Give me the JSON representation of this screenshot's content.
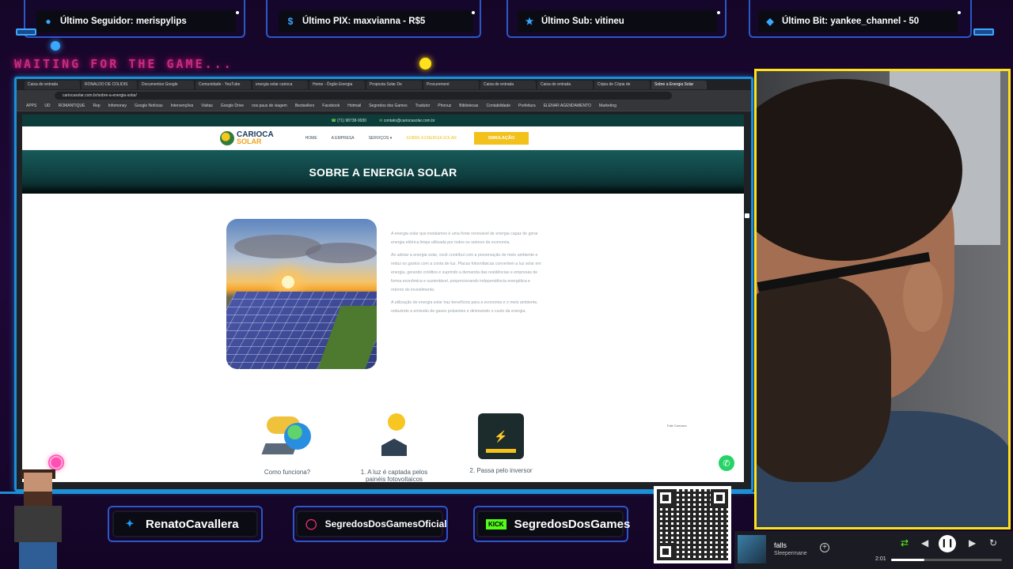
{
  "overlay": {
    "waiting_text": "WAITING FOR THE GAME...",
    "latest": [
      {
        "label": "Último Seguidor: merispylips",
        "icon": "user-icon"
      },
      {
        "label": "Último PIX: maxvianna - R$5",
        "icon": "dollar-icon"
      },
      {
        "label": "Último Sub: vitineu",
        "icon": "star-icon"
      },
      {
        "label": "Último Bit: yankee_channel - 50",
        "icon": "gem-icon"
      }
    ]
  },
  "browser": {
    "tabs": [
      "Caixa de entrada",
      "RONALDO DE COLIDIS",
      "Documentos Google",
      "Comunidade - YouTube",
      "energia solar carioca",
      "Home - Órgão Energia",
      "Proposta Solar De",
      "Procurement",
      "Caixa de entrada",
      "Caixa de entrada",
      "Cópia de Cópia de",
      "Sobre a Energia Solar"
    ],
    "active_tab_index": 11,
    "url": "cariocasolar.com.br/sobre-a-energia-solar/",
    "bookmarks": [
      "APPS",
      "UD",
      "ROMANTIQUE",
      "Rep",
      "Infomoney",
      "Google Notícias",
      "Intervenções",
      "Visitas",
      "Google Drive",
      "nos paus de viagem",
      "Bestsellers",
      "Facebook",
      "Hotmail",
      "Segredos dos Games",
      "Tradutor",
      "Phonuz",
      "Bibliotecas",
      "Contabilidade",
      "Prefeitura",
      "ELENAR AGENDAMENTO",
      "Marketing"
    ]
  },
  "site": {
    "phone": "(71) 98738-9930",
    "email": "contato@cariocasolar.com.br",
    "logo": {
      "line1": "CARIOCA",
      "line2": "SOLAR"
    },
    "menu": [
      "HOME",
      "A EMPRESA",
      "SERVIÇOS ▾",
      "SOBRE A ENERGIA SOLAR"
    ],
    "cta": "SIMULAÇÃO",
    "hero_title": "SOBRE A ENERGIA SOLAR",
    "paragraphs": [
      "A energia solar que instalamos é uma fonte renovável de energia capaz de gerar energia elétrica limpa utilizada por todos os setores da economia.",
      "Ao adotar a energia solar, você contribui com a preservação do meio ambiente e reduz os gastos com a conta de luz. Placas fotovoltaicas convertem a luz solar em energia, gerando créditos e suprindo a demanda das residências e empresas de forma econômica e sustentável, proporcionando independência energética e retorno do investimento.",
      "A utilização de energia solar traz benefícios para a economia e o meio ambiente, reduzindo a emissão de gases poluentes e diminuindo o custo da energia."
    ],
    "steps": [
      {
        "label": "Como funciona?"
      },
      {
        "label": "1. A luz é captada pelos painéis fotovoltaicos"
      },
      {
        "label": "2. Passa pelo inversor"
      }
    ],
    "whatsapp_label": "Fale Conosco"
  },
  "socials": [
    {
      "label": "RenatoCavallera",
      "icon": "twitter-icon"
    },
    {
      "label": "SegredosDosGamesOficial",
      "icon": "instagram-icon"
    },
    {
      "label": "SegredosDosGames",
      "icon": "kick-icon",
      "badge": "KICK"
    }
  ],
  "qr": {
    "label": "livepix.gg/segredosdosgames"
  },
  "player": {
    "song": "falls",
    "artist": "Sleepermane",
    "elapsed": "2:01",
    "progress": 0.3
  },
  "colors": {
    "accent_blue": "#1c8fd6",
    "webcam_border": "#ffe21a",
    "site_hero": "#175a59",
    "cta_yellow": "#f3c11b"
  }
}
